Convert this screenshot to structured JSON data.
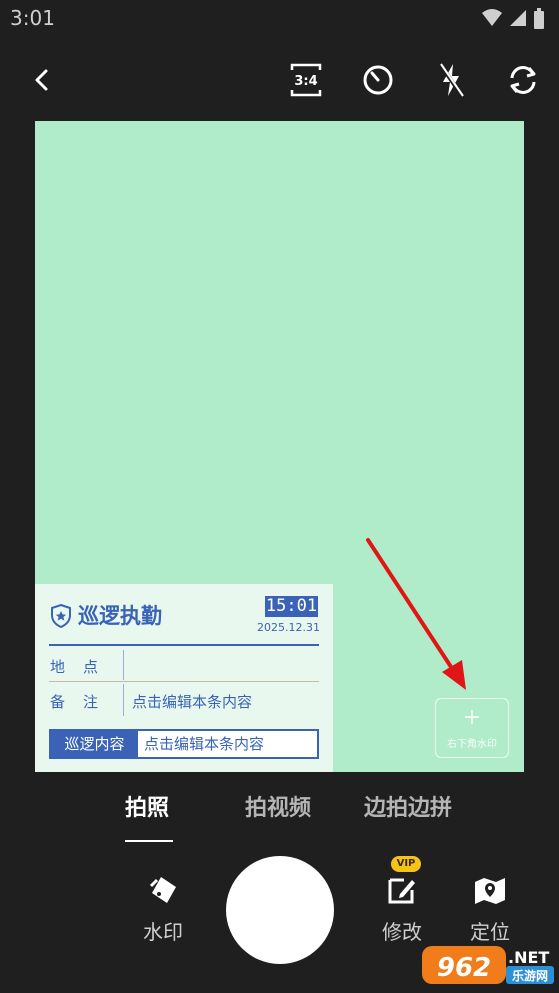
{
  "status_bar": {
    "time": "3:01"
  },
  "topbar": {
    "back_icon": "back-arrow-icon",
    "ratio_label": "3:4",
    "timer_icon": "timer-icon",
    "flash_icon": "flash-off-icon",
    "switch_icon": "switch-camera-icon"
  },
  "watermark": {
    "title": "巡逻执勤",
    "time": "15:01",
    "date": "2025.12.31",
    "location_label": "地点",
    "location_value": "",
    "note_label": "备注",
    "note_value": "点击编辑本条内容",
    "patrol_label": "巡逻内容",
    "patrol_value": "点击编辑本条内容"
  },
  "corner_watermark": {
    "plus": "+",
    "label": "右下角水印"
  },
  "modes": [
    {
      "label": "拍照",
      "active": true
    },
    {
      "label": "拍视频",
      "active": false
    },
    {
      "label": "边拍边拼",
      "active": false
    }
  ],
  "tools": {
    "watermark_label": "水印",
    "edit_label": "修改",
    "vip_badge": "VIP",
    "location_label": "定位"
  },
  "site_logo": {
    "text_num": "962",
    "text_net": ".NET",
    "text_cn": "乐游网"
  },
  "colors": {
    "preview_bg": "#b0ecca",
    "accent_blue": "#3a63b8",
    "arrow_red": "#e01515",
    "vip_yellow": "#f5c318"
  }
}
